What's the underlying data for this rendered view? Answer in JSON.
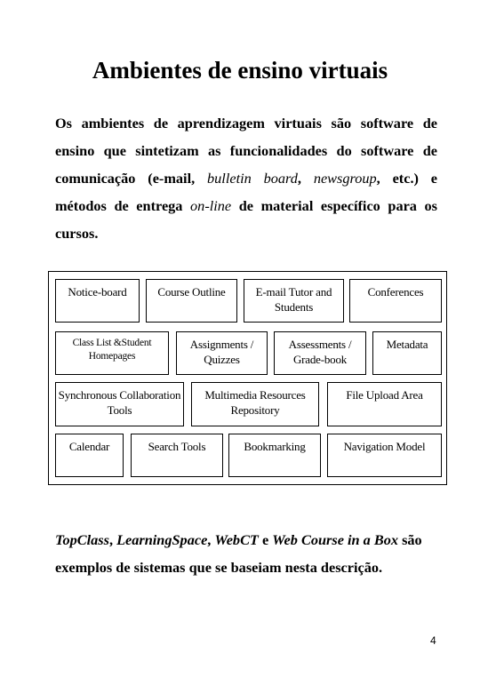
{
  "title": "Ambientes de ensino virtuais",
  "intro": {
    "t1": "Os ambientes de aprendizagem virtuais são software de ensino que sintetizam as funcionalidades do software de comunicação (e-mail, ",
    "i1": "bulletin board",
    "t2": ", ",
    "i2": "newsgroup",
    "t3": ", etc.) e métodos de entrega ",
    "i3": "on-line",
    "t4": " de material específico para os cursos."
  },
  "diagram": {
    "boxes": [
      {
        "label": "Notice-board"
      },
      {
        "label": "Course Outline"
      },
      {
        "label": "E-mail Tutor and Students"
      },
      {
        "label": "Conferences"
      },
      {
        "label": "Class List &Student Homepages"
      },
      {
        "label": "Assignments / Quizzes"
      },
      {
        "label": "Assessments / Grade-book"
      },
      {
        "label": "Metadata"
      },
      {
        "label": "Synchronous Collaboration Tools"
      },
      {
        "label": "Multimedia Resources Repository"
      },
      {
        "label": "File Upload Area"
      },
      {
        "label": "Calendar"
      },
      {
        "label": "Search Tools"
      },
      {
        "label": "Bookmarking"
      },
      {
        "label": "Navigation Model"
      }
    ]
  },
  "closing": {
    "s1": "TopClass",
    "c1": ", ",
    "s2": "LearningSpace",
    "c2": ", ",
    "s3": "WebCT",
    "c3": " e ",
    "s4": "Web Course in a Box",
    "rest": " são exemplos de sistemas que se baseiam nesta descrição."
  },
  "page_number": "4"
}
